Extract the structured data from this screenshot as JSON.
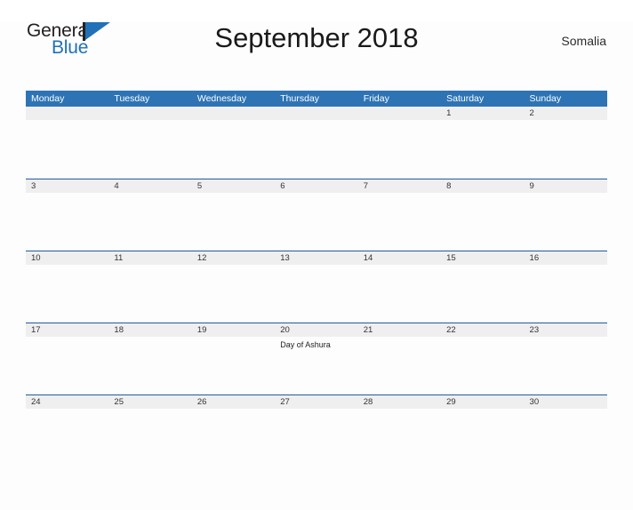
{
  "brand": {
    "word_one": "General",
    "word_two": "Blue",
    "flag_icon": "blue-flag-triangle-icon",
    "accent_color": "#2071b8"
  },
  "header": {
    "title": "September 2018",
    "country": "Somalia"
  },
  "theme": {
    "header_blue": "#2e74b5",
    "rule_blue": "#1f5c99",
    "band_gray": "#efefef",
    "page_bg": "#fdfdfd",
    "text_dark": "#333333"
  },
  "calendar": {
    "weekdays": [
      "Monday",
      "Tuesday",
      "Wednesday",
      "Thursday",
      "Friday",
      "Saturday",
      "Sunday"
    ],
    "weeks": [
      [
        {
          "date": "",
          "events": []
        },
        {
          "date": "",
          "events": []
        },
        {
          "date": "",
          "events": []
        },
        {
          "date": "",
          "events": []
        },
        {
          "date": "",
          "events": []
        },
        {
          "date": "1",
          "events": []
        },
        {
          "date": "2",
          "events": []
        }
      ],
      [
        {
          "date": "3",
          "events": []
        },
        {
          "date": "4",
          "events": []
        },
        {
          "date": "5",
          "events": []
        },
        {
          "date": "6",
          "events": []
        },
        {
          "date": "7",
          "events": []
        },
        {
          "date": "8",
          "events": []
        },
        {
          "date": "9",
          "events": []
        }
      ],
      [
        {
          "date": "10",
          "events": []
        },
        {
          "date": "11",
          "events": []
        },
        {
          "date": "12",
          "events": []
        },
        {
          "date": "13",
          "events": []
        },
        {
          "date": "14",
          "events": []
        },
        {
          "date": "15",
          "events": []
        },
        {
          "date": "16",
          "events": []
        }
      ],
      [
        {
          "date": "17",
          "events": []
        },
        {
          "date": "18",
          "events": []
        },
        {
          "date": "19",
          "events": []
        },
        {
          "date": "20",
          "events": [
            "Day of Ashura"
          ]
        },
        {
          "date": "21",
          "events": []
        },
        {
          "date": "22",
          "events": []
        },
        {
          "date": "23",
          "events": []
        }
      ],
      [
        {
          "date": "24",
          "events": []
        },
        {
          "date": "25",
          "events": []
        },
        {
          "date": "26",
          "events": []
        },
        {
          "date": "27",
          "events": []
        },
        {
          "date": "28",
          "events": []
        },
        {
          "date": "29",
          "events": []
        },
        {
          "date": "30",
          "events": []
        }
      ]
    ]
  }
}
